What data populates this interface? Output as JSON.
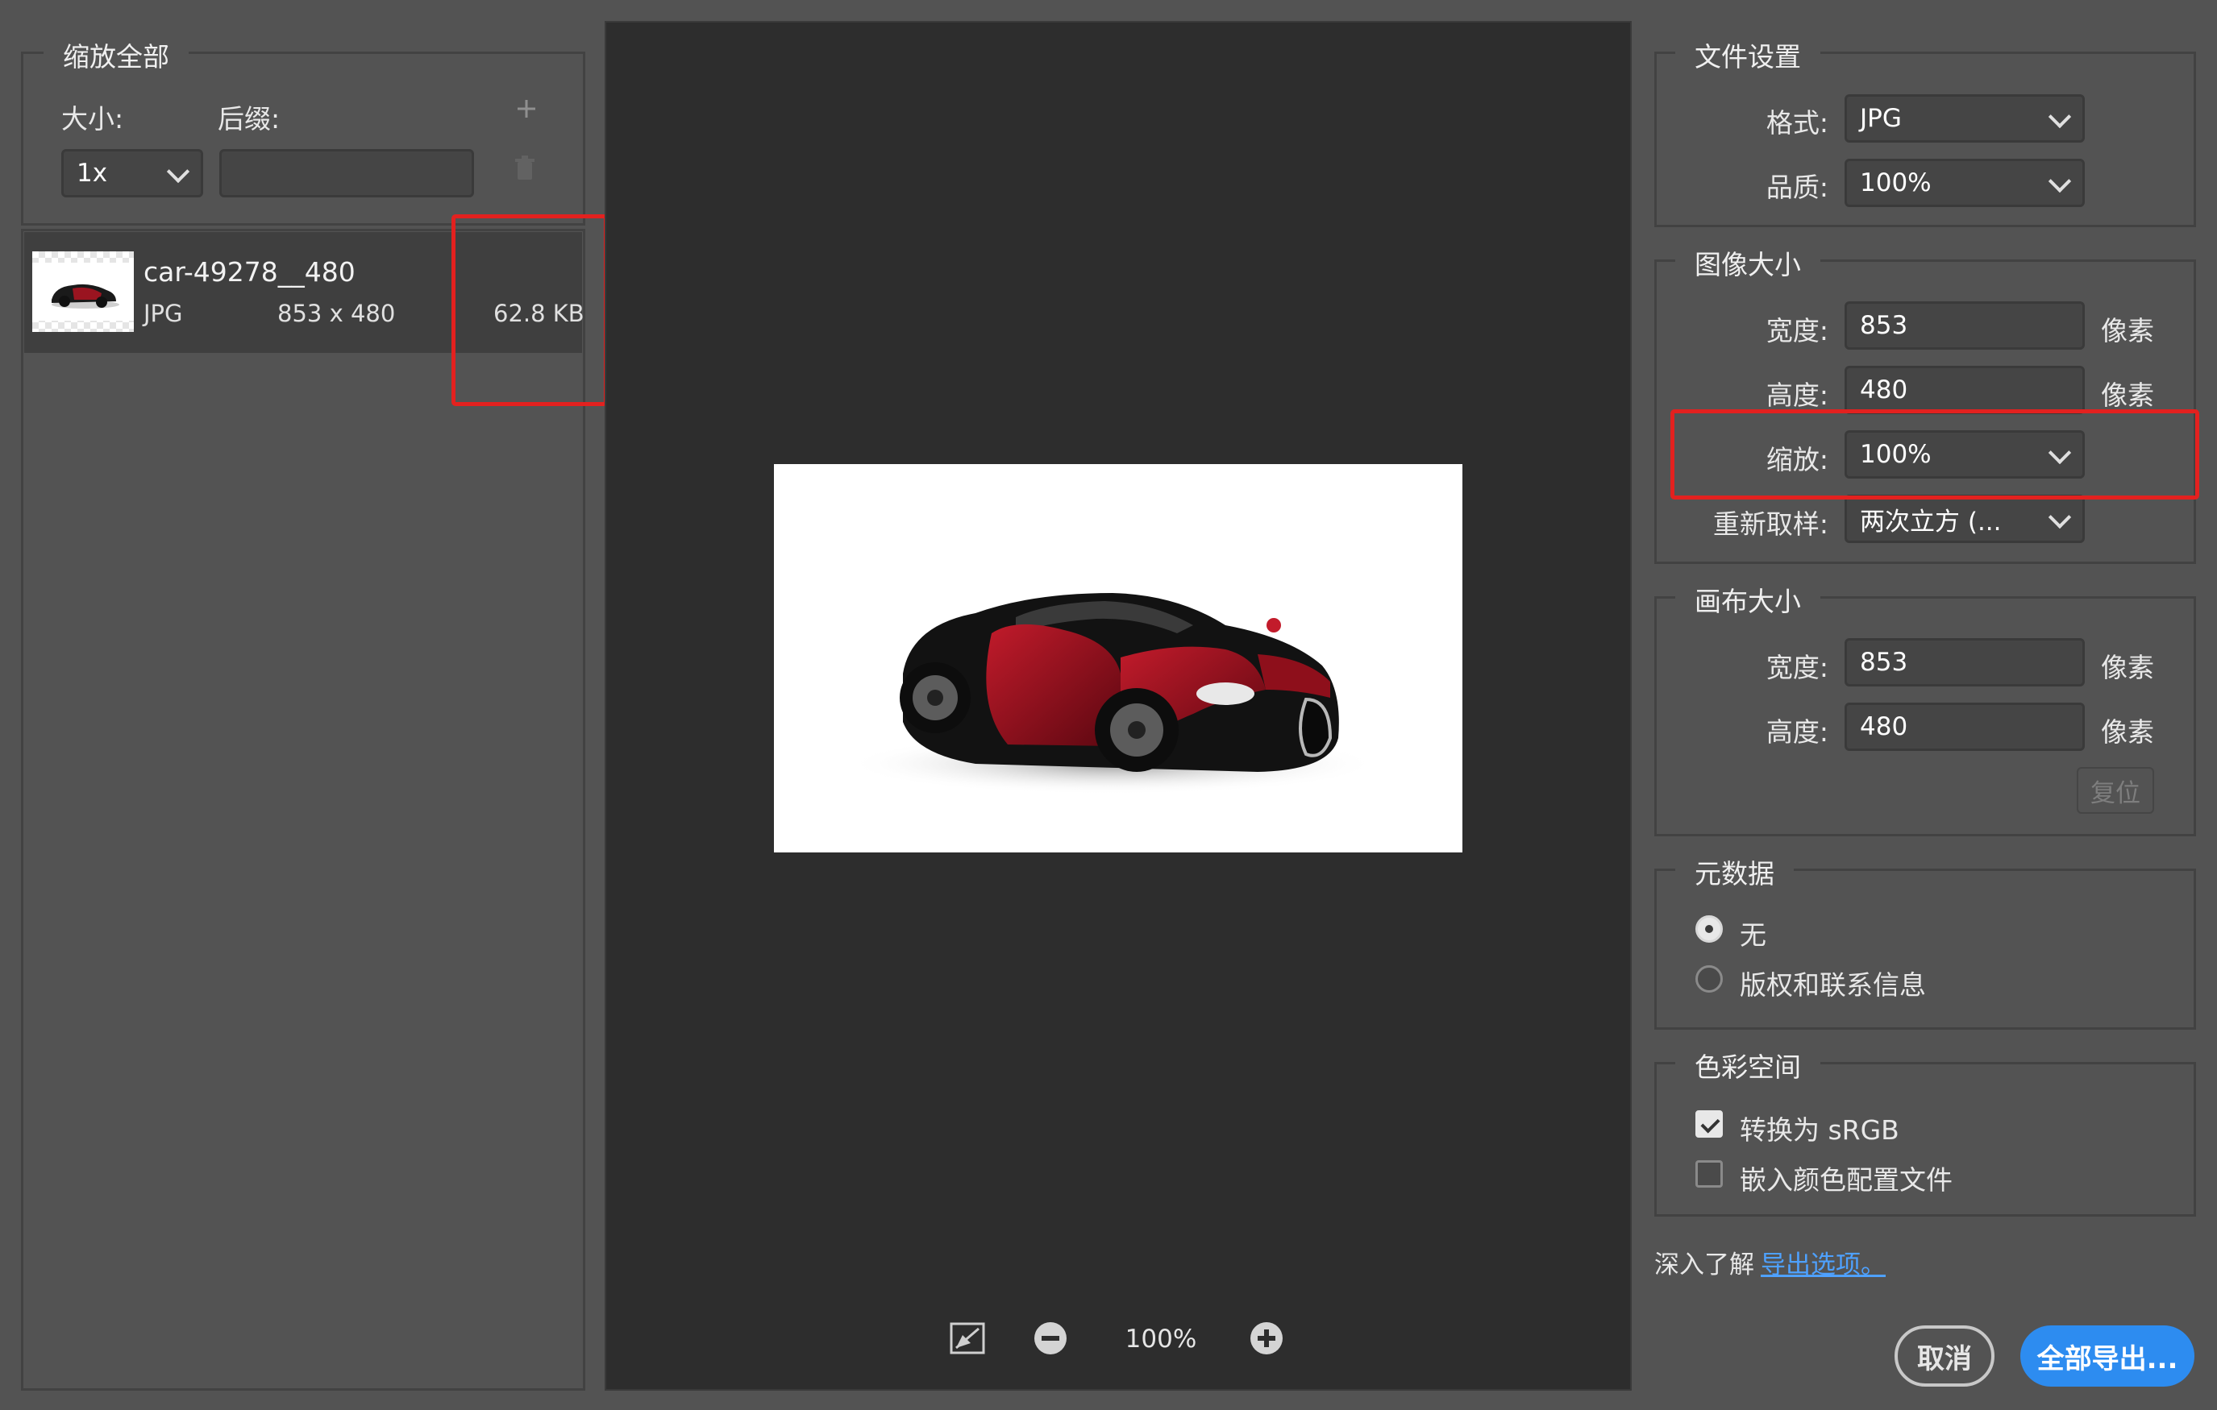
{
  "left": {
    "section_title": "缩放全部",
    "size_label": "大小:",
    "suffix_label": "后缀:",
    "size_value": "1x",
    "suffix_value": "",
    "item": {
      "name": "car-49278__480",
      "format": "JPG",
      "dimensions": "853 x 480",
      "filesize": "62.8 KB"
    }
  },
  "preview": {
    "zoom": "100%"
  },
  "right": {
    "file_settings": {
      "title": "文件设置",
      "format_label": "格式:",
      "format_value": "JPG",
      "quality_label": "品质:",
      "quality_value": "100%"
    },
    "image_size": {
      "title": "图像大小",
      "width_label": "宽度:",
      "width_value": "853",
      "height_label": "高度:",
      "height_value": "480",
      "scale_label": "缩放:",
      "scale_value": "100%",
      "resample_label": "重新取样:",
      "resample_value": "两次立方 (...",
      "unit": "像素"
    },
    "canvas_size": {
      "title": "画布大小",
      "width_label": "宽度:",
      "width_value": "853",
      "height_label": "高度:",
      "height_value": "480",
      "unit": "像素",
      "reset_label": "复位"
    },
    "metadata": {
      "title": "元数据",
      "option_none": "无",
      "option_copyright": "版权和联系信息"
    },
    "color_space": {
      "title": "色彩空间",
      "convert_srgb": "转换为 sRGB",
      "embed_profile": "嵌入颜色配置文件"
    },
    "learn_more": "深入了解",
    "learn_link": "导出选项。",
    "cancel": "取消",
    "export_all": "全部导出..."
  },
  "colors": {
    "accent": "#2d8cf0",
    "highlight": "#e3211f",
    "link": "#4ea1ff"
  }
}
